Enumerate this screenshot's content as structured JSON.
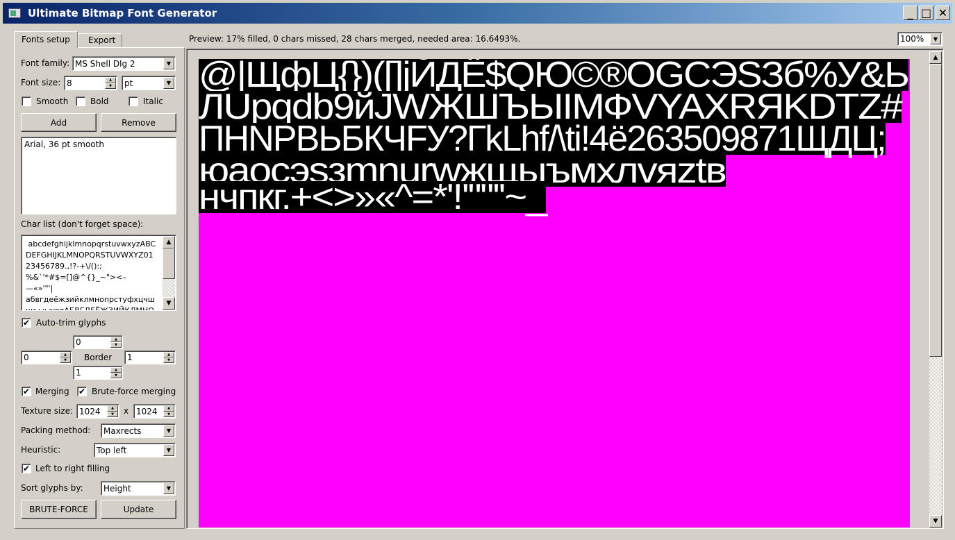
{
  "window": {
    "title": "Ultimate Bitmap Font Generator",
    "minimize": "_",
    "maximize": "□",
    "close": "✕"
  },
  "tabs": [
    {
      "label": "Fonts setup",
      "active": true
    },
    {
      "label": "Export",
      "active": false
    }
  ],
  "fonts": {
    "family_label": "Font family:",
    "family_value": "MS Shell Dlg 2",
    "size_label": "Font size:",
    "size_value": "8",
    "unit_value": "pt",
    "smooth_label": "Smooth",
    "smooth": false,
    "bold_label": "Bold",
    "bold": false,
    "italic_label": "Italic",
    "italic": false,
    "add_label": "Add",
    "remove_label": "Remove",
    "font_list": [
      "Arial, 36 pt smooth"
    ]
  },
  "charlist": {
    "label": "Char list (don't forget space):",
    "lines": [
      " abcdefghijklmnopqrstuvwxyzABC",
      "DEFGHIJKLMNOPQRSTUVWXYZ01",
      "23456789.,!?-+\\/():;",
      "%&`'*#$=[]@^{}_~\"><–",
      "—«»'\"'|",
      "абвгдеёжзийклмнопрстуфхцчш",
      "щъыьэюяАБВГДЕЁЖЗИЙКЛМНО"
    ]
  },
  "auto_trim": {
    "label": "Auto-trim glyphs",
    "checked": true
  },
  "border": {
    "label": "Border",
    "top": "0",
    "left": "0",
    "right": "1",
    "bottom": "1"
  },
  "merging": {
    "label": "Merging",
    "checked": true
  },
  "brute_merging": {
    "label": "Brute-force merging",
    "checked": true
  },
  "texture": {
    "label": "Texture size:",
    "width": "1024",
    "x": "x",
    "height": "1024"
  },
  "packing": {
    "label": "Packing method:",
    "value": "Maxrects"
  },
  "heuristic": {
    "label": "Heuristic:",
    "value": "Top left"
  },
  "ltr": {
    "label": "Left to right filling",
    "checked": true
  },
  "sort": {
    "label": "Sort glyphs by:",
    "value": "Height"
  },
  "buttons": {
    "bruteforce": "BRUTE-FORCE",
    "update": "Update"
  },
  "preview": {
    "status": "Preview: 17% filled, 0 chars missed, 28 chars merged, needed area: 16.6493%.",
    "zoom": "100%",
    "background_color": "#ff00ff",
    "rows": [
      "@|ЩфЦ{})([]jЙДЁ$QЮ©®OGCЭSЗб%У&Ь",
      "ЛUpqdb9йJWЖШЪЫIМФVYAXRЯKDTZ#",
      "ПHNPBЬБКЧFУ?ГkLhf/\\ti!4ё263509871ЩДЦ;",
      "юаосэsзmnurwжщыъмхлvяztв",
      "нчпкг.+<>»«^=*'!'\"\"''~_"
    ]
  }
}
